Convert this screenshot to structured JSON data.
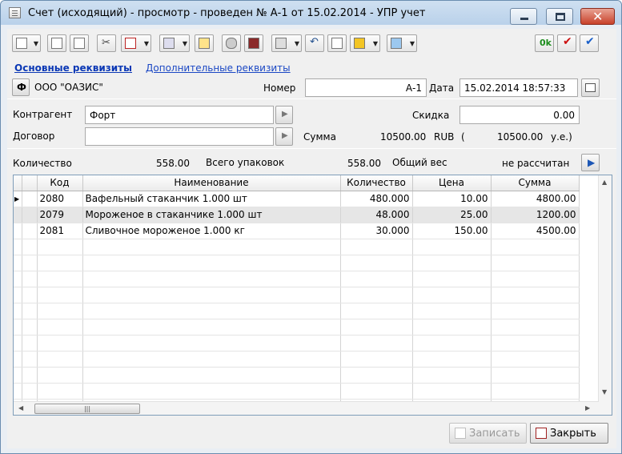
{
  "window": {
    "title": "Счет (исходящий) - просмотр - проведен № А-1 от 15.02.2014 - УПР учет"
  },
  "toolbar": {
    "ok_label": "0k"
  },
  "tabs": {
    "main": "Основные реквизиты",
    "additional": "Дополнительные реквизиты"
  },
  "header": {
    "firm_button": "Ф",
    "firm_name": "ООО \"ОАЗИС\"",
    "number_label": "Номер",
    "number_value": "А-1",
    "date_label": "Дата",
    "date_value": "15.02.2014 18:57:33"
  },
  "contract": {
    "counterparty_label": "Контрагент",
    "counterparty_value": "Форт",
    "agreement_label": "Договор",
    "agreement_value": "",
    "discount_label": "Скидка",
    "discount_value": "0.00",
    "sum_label": "Сумма",
    "sum_value": "10500.00",
    "sum_currency": "RUB",
    "sum_paren": "(",
    "sum_ue_value": "10500.00",
    "sum_ue_unit": "у.е.)"
  },
  "totals": {
    "qty_label": "Количество",
    "qty_value": "558.00",
    "packages_label": "Всего упаковок",
    "packages_value": "558.00",
    "weight_label": "Общий вес",
    "weight_value": "не рассчитан"
  },
  "table": {
    "columns": [
      "Код",
      "Наименование",
      "Количество",
      "Цена",
      "Сумма"
    ],
    "rows": [
      {
        "code": "2080",
        "name": "Вафельный стаканчик 1.000 шт",
        "qty": "480.000",
        "price": "10.00",
        "sum": "4800.00"
      },
      {
        "code": "2079",
        "name": "Мороженое в стаканчике 1.000 шт",
        "qty": "48.000",
        "price": "25.00",
        "sum": "1200.00"
      },
      {
        "code": "2081",
        "name": "Сливочное мороженое 1.000 кг",
        "qty": "30.000",
        "price": "150.00",
        "sum": "4500.00"
      }
    ]
  },
  "buttons": {
    "save": "Записать",
    "close": "Закрыть"
  }
}
